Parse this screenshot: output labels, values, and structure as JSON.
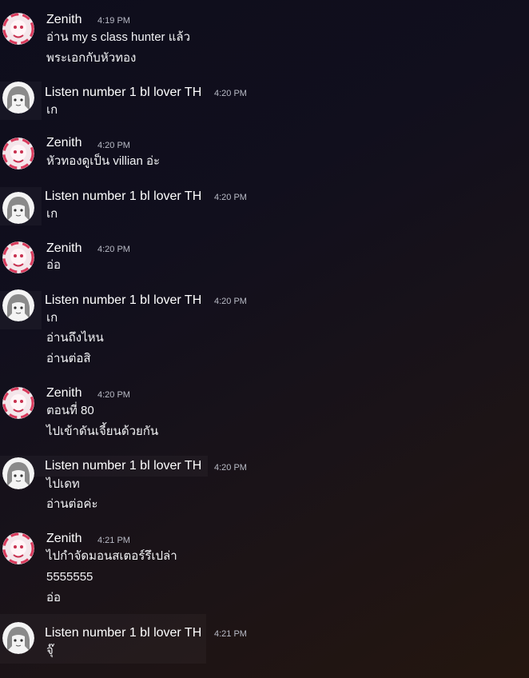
{
  "users": {
    "zenith": {
      "name": "Zenith",
      "accent": "#e24a6a"
    },
    "listen": {
      "name": "Listen number 1 bl lover TH",
      "accent": "#cfcfcf"
    }
  },
  "messages": [
    {
      "author": "Zenith",
      "time": "4:19 PM",
      "lines": [
        "อ่าน my s class hunter แล้ว",
        "พระเอกกับหัวทอง"
      ]
    },
    {
      "author": "Listen number 1 bl lover TH",
      "time": "4:20 PM",
      "lines": [
        "เก"
      ]
    },
    {
      "author": "Zenith",
      "time": "4:20 PM",
      "lines": [
        "หัวทองดูเป็น villian อ่ะ"
      ]
    },
    {
      "author": "Listen number 1 bl lover TH",
      "time": "4:20 PM",
      "lines": [
        "เก"
      ]
    },
    {
      "author": "Zenith",
      "time": "4:20 PM",
      "lines": [
        "อ่อ"
      ]
    },
    {
      "author": "Listen number 1 bl lover TH",
      "time": "4:20 PM",
      "lines": [
        "เก",
        "อ่านถึงไหน",
        "อ่านต่อสิ"
      ]
    },
    {
      "author": "Zenith",
      "time": "4:20 PM",
      "lines": [
        "ตอนที่ 80",
        "ไปเข้าดันเจี้ยนด้วยกัน"
      ]
    },
    {
      "author": "Listen number 1 bl lover TH",
      "time": "4:20 PM",
      "lines": [
        "ไปเดท",
        "อ่านต่อค่ะ"
      ]
    },
    {
      "author": "Zenith",
      "time": "4:21 PM",
      "lines": [
        "ไปกำจัดมอนสเตอร์รึเปล่า",
        "5555555",
        "อ่อ"
      ]
    },
    {
      "author": "Listen number 1 bl lover TH",
      "time": "4:21 PM",
      "lines": [
        "จุ๊"
      ]
    }
  ]
}
